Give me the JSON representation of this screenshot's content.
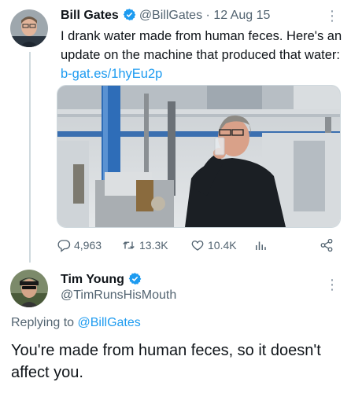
{
  "tweet": {
    "author_name": "Bill Gates",
    "handle": "@BillGates",
    "separator": "·",
    "date": "12 Aug 15",
    "text": "I drank water made from human feces. Here's an update on the machine that produced that water: ",
    "link": "b-gat.es/1hyEu2p",
    "more_icon": "more-vertical-icon",
    "stats": {
      "replies": "4,963",
      "retweets": "13.3K",
      "likes": "10.4K"
    }
  },
  "reply": {
    "author_name": "Tim Young",
    "handle": "@TimRunsHisMouth",
    "replying_prefix": "Replying to ",
    "replying_to": "@BillGates",
    "text": "You're made from human feces, so it doesn't affect you."
  },
  "colors": {
    "accent": "#1d9bf0",
    "secondary_text": "#536471",
    "divider": "#cfd9de"
  }
}
